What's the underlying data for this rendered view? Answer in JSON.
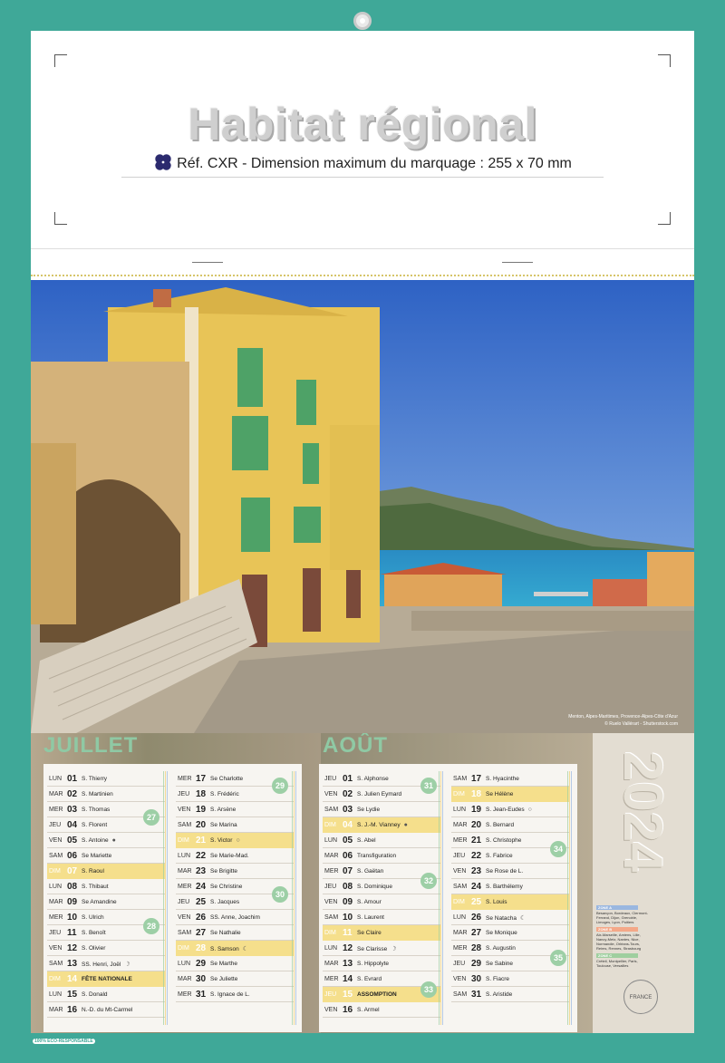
{
  "header": {
    "title": "Habitat régional",
    "subtitle": "Réf. CXR - Dimension maximum du marquage : 255 x 70 mm"
  },
  "photo": {
    "caption": "Menton, Alpes-Maritimes, Provence-Alpes-Côte d'Azur",
    "credit": "© Ruelo Vallérart - Shutterstock.com"
  },
  "calendar": {
    "year": "2024",
    "months": [
      {
        "name": "JUILLET",
        "columns": [
          [
            {
              "dw": "LUN",
              "d": "01",
              "s": "S. Thierry"
            },
            {
              "dw": "MAR",
              "d": "02",
              "s": "S. Martinien"
            },
            {
              "dw": "MER",
              "d": "03",
              "s": "S. Thomas"
            },
            {
              "dw": "JEU",
              "d": "04",
              "s": "S. Florent"
            },
            {
              "dw": "VEN",
              "d": "05",
              "s": "S. Antoine",
              "m": "●"
            },
            {
              "dw": "SAM",
              "d": "06",
              "s": "Se Mariette"
            },
            {
              "dw": "DIM",
              "d": "07",
              "s": "S. Raoul",
              "sun": true
            },
            {
              "dw": "LUN",
              "d": "08",
              "s": "S. Thibaut"
            },
            {
              "dw": "MAR",
              "d": "09",
              "s": "Se Amandine"
            },
            {
              "dw": "MER",
              "d": "10",
              "s": "S. Ulrich"
            },
            {
              "dw": "JEU",
              "d": "11",
              "s": "S. Benoît"
            },
            {
              "dw": "VEN",
              "d": "12",
              "s": "S. Olivier"
            },
            {
              "dw": "SAM",
              "d": "13",
              "s": "SS. Henri, Joël",
              "m": "☽"
            },
            {
              "dw": "DIM",
              "d": "14",
              "s": "FÊTE NATIONALE",
              "sun": true,
              "b": true
            },
            {
              "dw": "LUN",
              "d": "15",
              "s": "S. Donald"
            },
            {
              "dw": "MAR",
              "d": "16",
              "s": "N.-D. du Mt-Carmel"
            }
          ],
          [
            {
              "dw": "MER",
              "d": "17",
              "s": "Se Charlotte"
            },
            {
              "dw": "JEU",
              "d": "18",
              "s": "S. Frédéric"
            },
            {
              "dw": "VEN",
              "d": "19",
              "s": "S. Arsène"
            },
            {
              "dw": "SAM",
              "d": "20",
              "s": "Se Marina"
            },
            {
              "dw": "DIM",
              "d": "21",
              "s": "S. Victor",
              "sun": true,
              "m": "○"
            },
            {
              "dw": "LUN",
              "d": "22",
              "s": "Se Marie-Mad."
            },
            {
              "dw": "MAR",
              "d": "23",
              "s": "Se Brigitte"
            },
            {
              "dw": "MER",
              "d": "24",
              "s": "Se Christine"
            },
            {
              "dw": "JEU",
              "d": "25",
              "s": "S. Jacques"
            },
            {
              "dw": "VEN",
              "d": "26",
              "s": "SS. Anne, Joachim"
            },
            {
              "dw": "SAM",
              "d": "27",
              "s": "Se Nathalie"
            },
            {
              "dw": "DIM",
              "d": "28",
              "s": "S. Samson",
              "sun": true,
              "m": "☾"
            },
            {
              "dw": "LUN",
              "d": "29",
              "s": "Se Marthe"
            },
            {
              "dw": "MAR",
              "d": "30",
              "s": "Se Juliette"
            },
            {
              "dw": "MER",
              "d": "31",
              "s": "S. Ignace de L."
            }
          ]
        ],
        "weeks": [
          "27",
          "28",
          "29",
          "30"
        ]
      },
      {
        "name": "AOÛT",
        "columns": [
          [
            {
              "dw": "JEU",
              "d": "01",
              "s": "S. Alphonse"
            },
            {
              "dw": "VEN",
              "d": "02",
              "s": "S. Julien Eymard"
            },
            {
              "dw": "SAM",
              "d": "03",
              "s": "Se Lydie"
            },
            {
              "dw": "DIM",
              "d": "04",
              "s": "S. J.-M. Vianney",
              "sun": true,
              "m": "●"
            },
            {
              "dw": "LUN",
              "d": "05",
              "s": "S. Abel"
            },
            {
              "dw": "MAR",
              "d": "06",
              "s": "Transfiguration"
            },
            {
              "dw": "MER",
              "d": "07",
              "s": "S. Gaëtan"
            },
            {
              "dw": "JEU",
              "d": "08",
              "s": "S. Dominique"
            },
            {
              "dw": "VEN",
              "d": "09",
              "s": "S. Amour"
            },
            {
              "dw": "SAM",
              "d": "10",
              "s": "S. Laurent"
            },
            {
              "dw": "DIM",
              "d": "11",
              "s": "Se Claire",
              "sun": true
            },
            {
              "dw": "LUN",
              "d": "12",
              "s": "Se Clarisse",
              "m": "☽"
            },
            {
              "dw": "MAR",
              "d": "13",
              "s": "S. Hippolyte"
            },
            {
              "dw": "MER",
              "d": "14",
              "s": "S. Evrard"
            },
            {
              "dw": "JEU",
              "d": "15",
              "s": "ASSOMPTION",
              "sun": true,
              "b": true
            },
            {
              "dw": "VEN",
              "d": "16",
              "s": "S. Armel"
            }
          ],
          [
            {
              "dw": "SAM",
              "d": "17",
              "s": "S. Hyacinthe"
            },
            {
              "dw": "DIM",
              "d": "18",
              "s": "Se Hélène",
              "sun": true
            },
            {
              "dw": "LUN",
              "d": "19",
              "s": "S. Jean-Eudes",
              "m": "○"
            },
            {
              "dw": "MAR",
              "d": "20",
              "s": "S. Bernard"
            },
            {
              "dw": "MER",
              "d": "21",
              "s": "S. Christophe"
            },
            {
              "dw": "JEU",
              "d": "22",
              "s": "S. Fabrice"
            },
            {
              "dw": "VEN",
              "d": "23",
              "s": "Se Rose de L."
            },
            {
              "dw": "SAM",
              "d": "24",
              "s": "S. Barthélemy"
            },
            {
              "dw": "DIM",
              "d": "25",
              "s": "S. Louis",
              "sun": true
            },
            {
              "dw": "LUN",
              "d": "26",
              "s": "Se Natacha",
              "m": "☾"
            },
            {
              "dw": "MAR",
              "d": "27",
              "s": "Se Monique"
            },
            {
              "dw": "MER",
              "d": "28",
              "s": "S. Augustin"
            },
            {
              "dw": "JEU",
              "d": "29",
              "s": "Se Sabine"
            },
            {
              "dw": "VEN",
              "d": "30",
              "s": "S. Fiacre"
            },
            {
              "dw": "SAM",
              "d": "31",
              "s": "S. Aristide"
            }
          ]
        ],
        "weeks": [
          "31",
          "32",
          "33",
          "34",
          "35"
        ]
      }
    ],
    "zones": [
      {
        "label": "ZONE A",
        "color": "#9ab7e0",
        "text": "Besançon, Bordeaux, Clermont-Ferrand, Dijon, Grenoble, Limoges, Lyon, Poitiers"
      },
      {
        "label": "ZONE B",
        "color": "#f4a888",
        "text": "Aix-Marseille, Amiens, Lille, Nancy-Metz, Nantes, Nice, Normandie, Orléans-Tours, Reims, Rennes, Strasbourg"
      },
      {
        "label": "ZONE C",
        "color": "#9fcf9f",
        "text": "Créteil, Montpellier, Paris, Toulouse, Versailles"
      }
    ],
    "badge": "FRANCE",
    "eco": "100% ECO-RESPONSABLE",
    "colors": {
      "sunday": "#f5df8c",
      "week": "#9dcfa6",
      "frame": "#3fa898"
    }
  }
}
